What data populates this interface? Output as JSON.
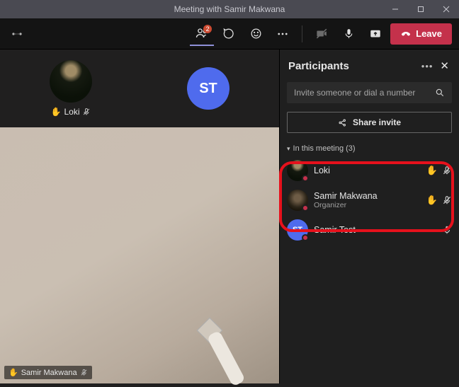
{
  "window": {
    "title": "Meeting with Samir Makwana"
  },
  "toolbar": {
    "people_badge": "2",
    "leave_label": "Leave"
  },
  "stage": {
    "tiles": [
      {
        "name": "Loki",
        "initials": "",
        "hand_raised": true,
        "mic_muted": true,
        "avatar": "loki"
      },
      {
        "name": "",
        "initials": "ST",
        "hand_raised": false,
        "mic_muted": false,
        "avatar": "st"
      }
    ],
    "speaker": {
      "name": "Samir Makwana",
      "hand_raised": true,
      "mic_muted": true
    }
  },
  "panel": {
    "title": "Participants",
    "invite_placeholder": "Invite someone or dial a number",
    "share_label": "Share invite",
    "section_label": "In this meeting (3)",
    "rows": [
      {
        "name": "Loki",
        "role": "",
        "avatar": "loki",
        "hand_raised": true,
        "mic_muted": true,
        "mic_on": false
      },
      {
        "name": "Samir Makwana",
        "role": "Organizer",
        "avatar": "samir",
        "hand_raised": true,
        "mic_muted": true,
        "mic_on": false
      },
      {
        "name": "Samir Test",
        "role": "",
        "avatar": "st",
        "initials": "ST",
        "hand_raised": false,
        "mic_muted": false,
        "mic_on": true
      }
    ]
  }
}
